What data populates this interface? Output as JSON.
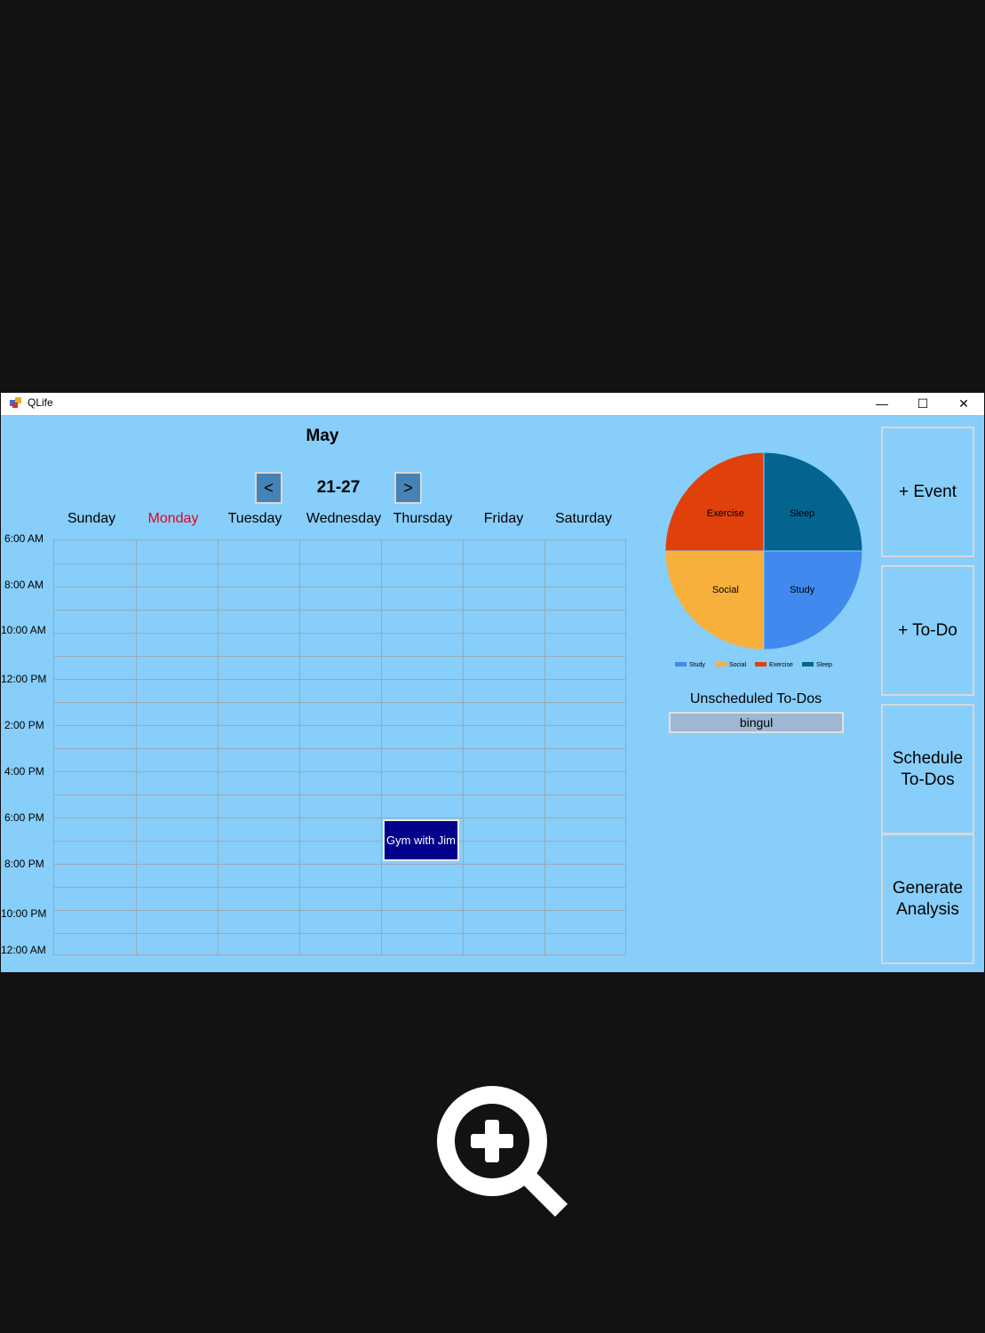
{
  "window": {
    "title": "QLife",
    "controls": {
      "minimize": "—",
      "maximize": "☐",
      "close": "✕"
    }
  },
  "calendar": {
    "month": "May",
    "week_range": "21-27",
    "prev_label": "<",
    "next_label": ">",
    "today_color": "#e8001e",
    "days": [
      "Sunday",
      "Monday",
      "Tuesday",
      "Wednesday",
      "Thursday",
      "Friday",
      "Saturday"
    ],
    "today_index": 1,
    "time_labels": [
      "6:00 AM",
      "8:00 AM",
      "10:00 AM",
      "12:00 PM",
      "2:00 PM",
      "4:00 PM",
      "6:00 PM",
      "8:00 PM",
      "10:00 PM",
      "12:00 AM"
    ],
    "events": [
      {
        "title": "Gym with Jim",
        "day": "Thursday",
        "start": "7:00 PM",
        "end": "8:00 PM",
        "color": "#00008b"
      }
    ]
  },
  "chart_data": {
    "type": "pie",
    "title": "",
    "slices": [
      {
        "label": "Study",
        "value": 25,
        "color": "#4189ee"
      },
      {
        "label": "Social",
        "value": 25,
        "color": "#f8b03c"
      },
      {
        "label": "Exercise",
        "value": 25,
        "color": "#e0400a"
      },
      {
        "label": "Sleep",
        "value": 25,
        "color": "#036490"
      }
    ],
    "legend": [
      "Study",
      "Social",
      "Exercise",
      "Sleep"
    ],
    "legend_placement": "bottom"
  },
  "todos": {
    "label": "Unscheduled To-Dos",
    "items": [
      "bingul"
    ]
  },
  "actions": {
    "add_event": "+ Event",
    "add_todo": "+ To-Do",
    "schedule_todos": "Schedule\nTo-Dos",
    "generate_analysis": "Generate\nAnalysis"
  },
  "overlay": {
    "zoom_icon": "zoom-in-icon"
  }
}
